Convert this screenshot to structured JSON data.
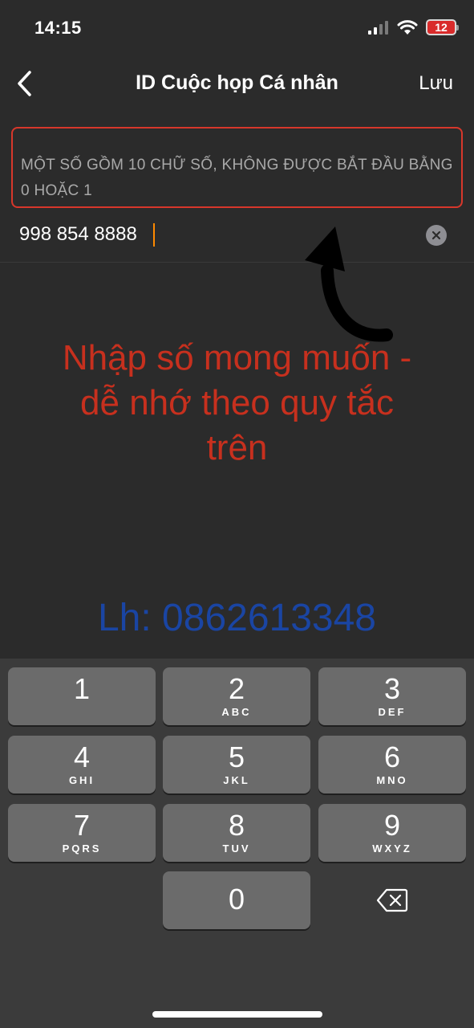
{
  "status": {
    "time": "14:15",
    "battery": "12"
  },
  "nav": {
    "title": "ID Cuộc họp Cá nhân",
    "save_label": "Lưu"
  },
  "hint": {
    "text": "MỘT SỐ GỒM 10 CHỮ SỐ, KHÔNG ĐƯỢC BẮT ĐẦU BẰNG 0 HOẶC 1"
  },
  "meeting_id": {
    "value": "998 854 8888"
  },
  "annotation": {
    "lines": [
      "Nhập số mong muốn  -",
      "dễ nhớ theo quy tắc",
      "trên"
    ],
    "color": "#c7301e"
  },
  "contact": {
    "text": "Lh: 0862613348",
    "color": "#1a45a3"
  },
  "keypad": {
    "keys": [
      {
        "digit": "1",
        "letters": ""
      },
      {
        "digit": "2",
        "letters": "ABC"
      },
      {
        "digit": "3",
        "letters": "DEF"
      },
      {
        "digit": "4",
        "letters": "GHI"
      },
      {
        "digit": "5",
        "letters": "JKL"
      },
      {
        "digit": "6",
        "letters": "MNO"
      },
      {
        "digit": "7",
        "letters": "PQRS"
      },
      {
        "digit": "8",
        "letters": "TUV"
      },
      {
        "digit": "9",
        "letters": "WXYZ"
      },
      {
        "digit": "0",
        "letters": ""
      }
    ]
  },
  "colors": {
    "accent_border": "#d7372b",
    "background": "#2b2b2b",
    "key": "#6b6b6b"
  },
  "icons": [
    "chevron-left-icon",
    "signal-icon",
    "wifi-icon",
    "battery-icon",
    "clear-icon",
    "arrow-icon",
    "backspace-icon"
  ]
}
